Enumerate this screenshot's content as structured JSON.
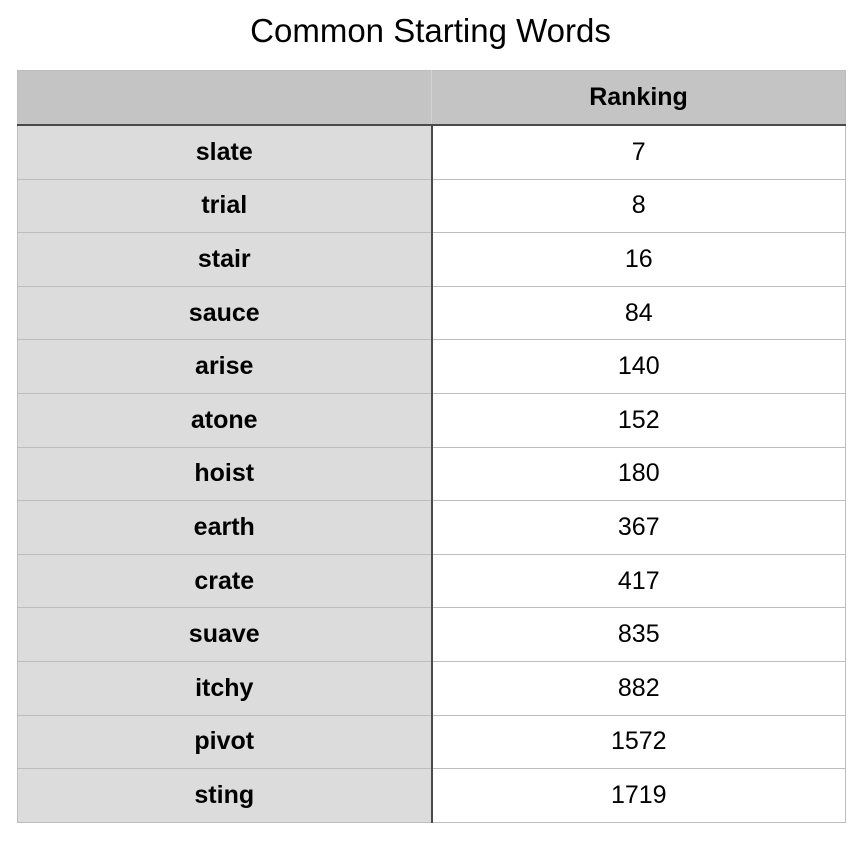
{
  "title": "Common Starting Words",
  "header": {
    "corner": "",
    "ranking": "Ranking"
  },
  "rows": [
    {
      "word": "slate",
      "ranking": "7"
    },
    {
      "word": "trial",
      "ranking": "8"
    },
    {
      "word": "stair",
      "ranking": "16"
    },
    {
      "word": "sauce",
      "ranking": "84"
    },
    {
      "word": "arise",
      "ranking": "140"
    },
    {
      "word": "atone",
      "ranking": "152"
    },
    {
      "word": "hoist",
      "ranking": "180"
    },
    {
      "word": "earth",
      "ranking": "367"
    },
    {
      "word": "crate",
      "ranking": "417"
    },
    {
      "word": "suave",
      "ranking": "835"
    },
    {
      "word": "itchy",
      "ranking": "882"
    },
    {
      "word": "pivot",
      "ranking": "1572"
    },
    {
      "word": "sting",
      "ranking": "1719"
    }
  ],
  "colors": {
    "header_fill": "#c4c4c4",
    "word_column_fill": "#dcdcdc",
    "value_fill": "#ffffff",
    "grid_line": "#bdbdbd",
    "divider_line": "#4a4a4a"
  }
}
